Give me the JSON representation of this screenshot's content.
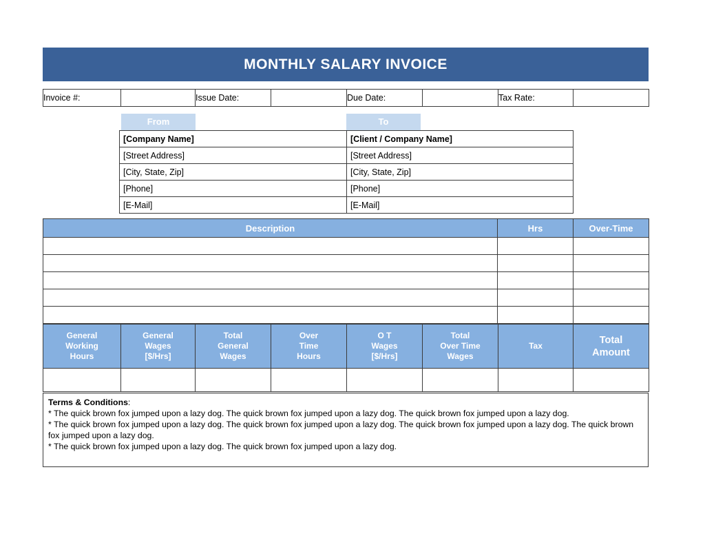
{
  "document": {
    "title": "MONTHLY SALARY INVOICE"
  },
  "colors": {
    "title_bar": "#3A6198",
    "header_blue": "#86B0E0",
    "light_blue": "#C5D9EF",
    "border": "#3B3B3B",
    "header_text": "#FFFFFF"
  },
  "info_row": {
    "invoice_number_label": "Invoice #:",
    "invoice_number_value": "",
    "issue_date_label": "Issue Date:",
    "issue_date_value": "",
    "due_date_label": "Due Date:",
    "due_date_value": "",
    "tax_rate_label": "Tax Rate:",
    "tax_rate_value": ""
  },
  "parties": {
    "from_heading": "From",
    "to_heading": "To",
    "from": {
      "company": "[Company Name]",
      "street": "[Street Address]",
      "city": "[City, State, Zip]",
      "phone": "[Phone]",
      "email": "[E-Mail]"
    },
    "to": {
      "company": "[Client / Company Name]",
      "street": "[Street Address]",
      "city": "[City, State, Zip]",
      "phone": "[Phone]",
      "email": "[E-Mail]"
    }
  },
  "line_items": {
    "headers": {
      "description": "Description",
      "hrs": "Hrs",
      "over_time": "Over-Time"
    },
    "rows": [
      {
        "description": "",
        "hrs": "",
        "over_time": ""
      },
      {
        "description": "",
        "hrs": "",
        "over_time": ""
      },
      {
        "description": "",
        "hrs": "",
        "over_time": ""
      },
      {
        "description": "",
        "hrs": "",
        "over_time": ""
      },
      {
        "description": "",
        "hrs": "",
        "over_time": ""
      }
    ]
  },
  "summary": {
    "headers": {
      "general_working_hours": "General\nWorking\nHours",
      "general_wages": "General\nWages\n[$/Hrs]",
      "total_general_wages": "Total\nGeneral\nWages",
      "over_time_hours": "Over\nTime\nHours",
      "ot_wages": "O T\nWages\n[$/Hrs]",
      "total_over_time_wages": "Total\nOver Time\nWages",
      "tax": "Tax",
      "total_amount": "Total\nAmount"
    },
    "values": {
      "general_working_hours": "",
      "general_wages": "",
      "total_general_wages": "",
      "over_time_hours": "",
      "ot_wages": "",
      "total_over_time_wages": "",
      "tax": "",
      "total_amount": ""
    }
  },
  "terms": {
    "title": "Terms & Conditions",
    "title_suffix": ":",
    "lines": [
      "* The quick brown fox jumped upon a lazy dog. The quick brown fox jumped upon a lazy dog. The quick brown fox jumped upon a lazy dog.",
      "* The quick brown fox jumped upon a lazy dog. The quick brown fox jumped upon a lazy dog. The quick brown fox jumped upon a lazy dog. The quick brown fox jumped upon a lazy dog.",
      "* The quick brown fox jumped upon a lazy dog. The quick brown fox jumped upon a lazy dog."
    ]
  }
}
